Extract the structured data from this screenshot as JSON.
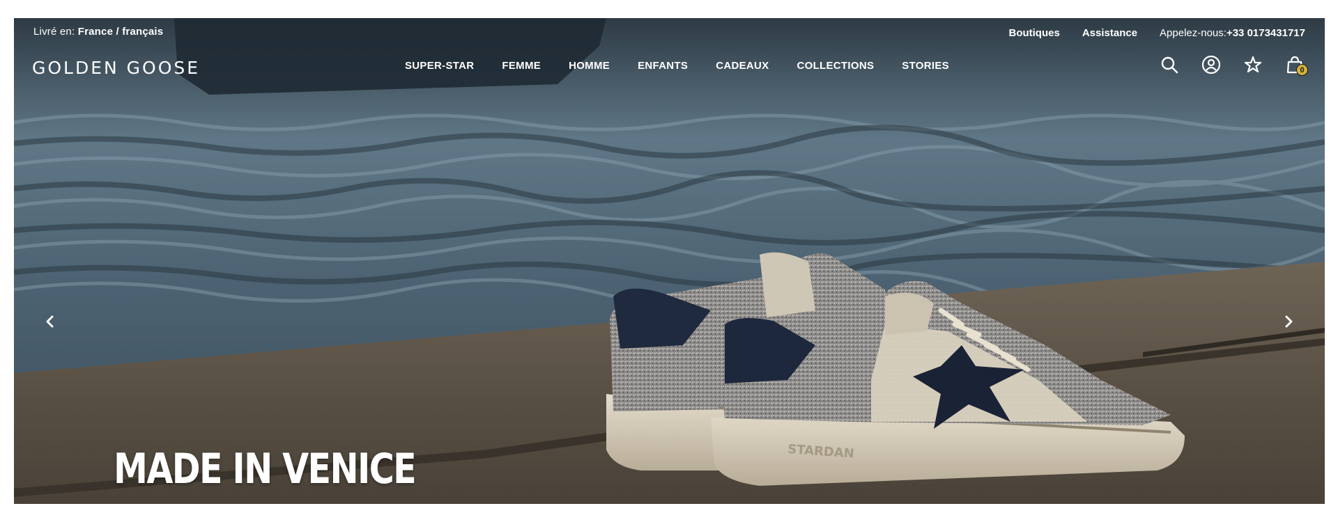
{
  "utility": {
    "delivery_label": "Livré en:",
    "delivery_value": "France / français",
    "links": [
      "Boutiques",
      "Assistance"
    ],
    "phone_label": "Appelez-nous:",
    "phone_number": "+33 0173431717"
  },
  "header": {
    "logo": "GOLDEN GOOSE",
    "nav": [
      "SUPER-STAR",
      "FEMME",
      "HOMME",
      "ENFANTS",
      "CADEAUX",
      "COLLECTIONS",
      "STORIES"
    ],
    "icons": [
      "search-icon",
      "account-icon",
      "wishlist-star-icon",
      "shopping-bag-icon"
    ],
    "cart_count": "0"
  },
  "hero": {
    "headline": "MADE IN VENICE",
    "prev_icon": "chevron-left-icon",
    "next_icon": "chevron-right-icon"
  },
  "colors": {
    "cart_badge": "#d4b33a",
    "text": "#ffffff"
  }
}
